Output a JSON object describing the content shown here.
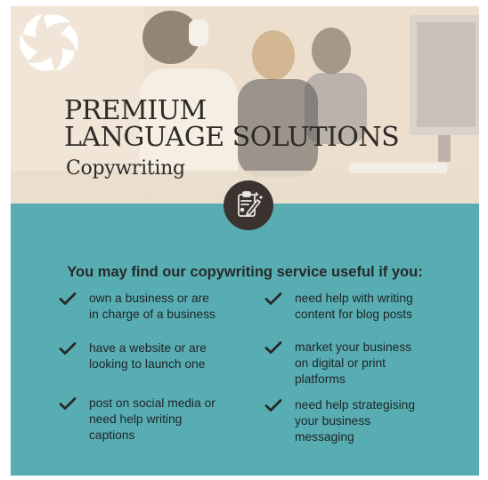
{
  "hero": {
    "title_line1": "PREMIUM",
    "title_line2": "LANGUAGE SOLUTIONS",
    "subtitle": "Copywriting",
    "logo_icon": "spiral-logo-icon",
    "badge_icon": "clipboard-pen-icon"
  },
  "colors": {
    "panel": "#58adb2",
    "text_dark": "#26292a",
    "badge": "#3a3330"
  },
  "headline": "You may find our copywriting service useful if you:",
  "items": [
    {
      "text": "own a business or are\nin charge of a business"
    },
    {
      "text": "have a website or are\nlooking to launch one"
    },
    {
      "text": "post on social media or\nneed help writing\ncaptions"
    },
    {
      "text": "need help with writing\ncontent for blog posts"
    },
    {
      "text": "market your business\non digital or print\nplatforms"
    },
    {
      "text": "need help strategising\nyour business\nmessaging"
    }
  ]
}
